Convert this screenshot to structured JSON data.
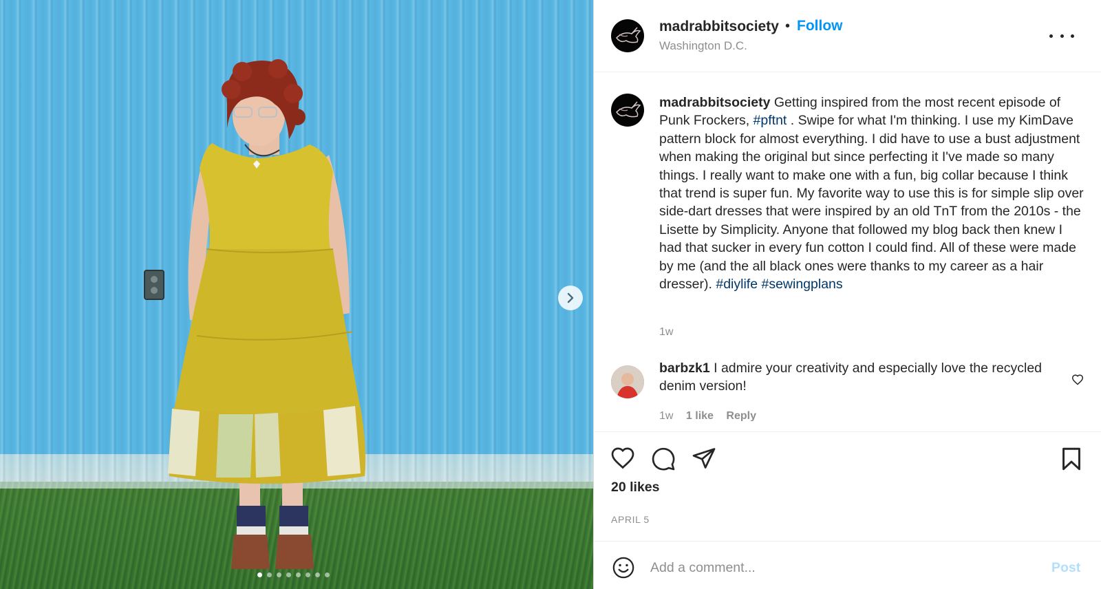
{
  "post": {
    "author": {
      "username": "madrabbitsociety",
      "location": "Washington D.C.",
      "avatar_icon": "rabbit-logo"
    },
    "follow_separator": "•",
    "follow_label": "Follow",
    "more_icon": "more-options-icon",
    "image": {
      "description_icon": "photo-carousel",
      "next_icon": "chevron-right-icon",
      "carousel_total": 8,
      "carousel_active_index": 0
    },
    "caption": {
      "username": "madrabbitsociety",
      "text_1": " Getting inspired from the most recent episode of Punk Frockers, ",
      "hashtag_1": "#pftnt",
      "text_2": " . Swipe for what I'm thinking. I use my KimDave pattern block for almost everything. I did have to use a bust adjustment when making the original but since perfecting it I've made so many things. I really want to make one with a fun, big collar because I think that trend is super fun. My favorite way to use this is for simple slip over side-dart dresses that were inspired by an old TnT from the 2010s - the Lisette by Simplicity. Anyone that followed my blog back then knew I had that sucker in every fun cotton I could find. All of these were made by me (and the all black ones were thanks to my career as a hair dresser). ",
      "hashtag_2": "#diylife",
      "hashtag_3": "#sewingplans",
      "time": "1w"
    },
    "comments": [
      {
        "username": "barbzk1",
        "text": " I admire your creativity and especially love the recycled denim version!",
        "time": "1w",
        "likes": "1 like",
        "reply_label": "Reply"
      }
    ],
    "actions": {
      "like_icon": "heart-icon",
      "comment_icon": "comment-icon",
      "share_icon": "share-icon",
      "save_icon": "bookmark-icon"
    },
    "likes_label": "20 likes",
    "date": "APRIL 5",
    "add_comment": {
      "emoji_icon": "emoji-icon",
      "placeholder": "Add a comment...",
      "post_label": "Post"
    }
  },
  "colors": {
    "link_blue": "#0095f6",
    "hashtag_blue": "#00376b",
    "muted_gray": "#8e8e8e",
    "post_disabled": "#b2dffc"
  }
}
